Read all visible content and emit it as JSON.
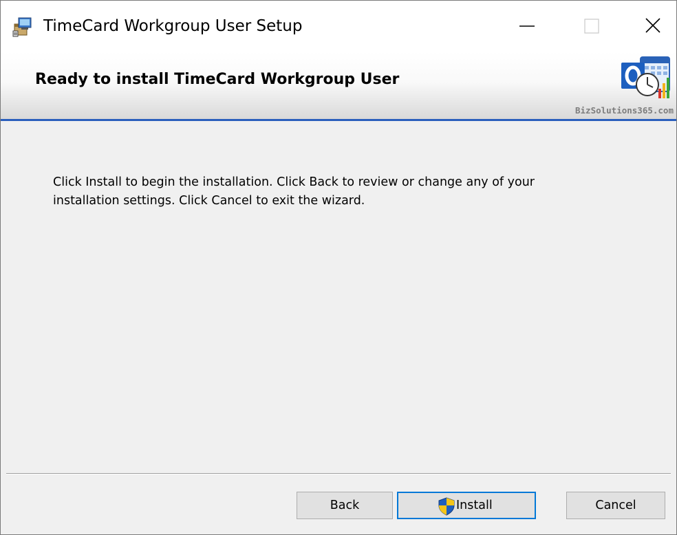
{
  "window": {
    "title": "TimeCard Workgroup User Setup"
  },
  "banner": {
    "title": "Ready to install TimeCard Workgroup User",
    "brand": "BizSolutions365.com"
  },
  "body": {
    "message": "Click Install to begin the installation. Click Back to review or change any of your installation settings. Click Cancel to exit the wizard."
  },
  "buttons": {
    "back": "Back",
    "install": "Install",
    "cancel": "Cancel"
  },
  "icons": {
    "app": "installer-package-icon",
    "minimize": "minimize-icon",
    "maximize": "maximize-icon",
    "close": "close-icon",
    "logo": "outlook-calendar-clock-logo",
    "shield": "uac-shield-icon"
  },
  "colors": {
    "accent": "#2a5fbd",
    "focus": "#0078d7"
  }
}
